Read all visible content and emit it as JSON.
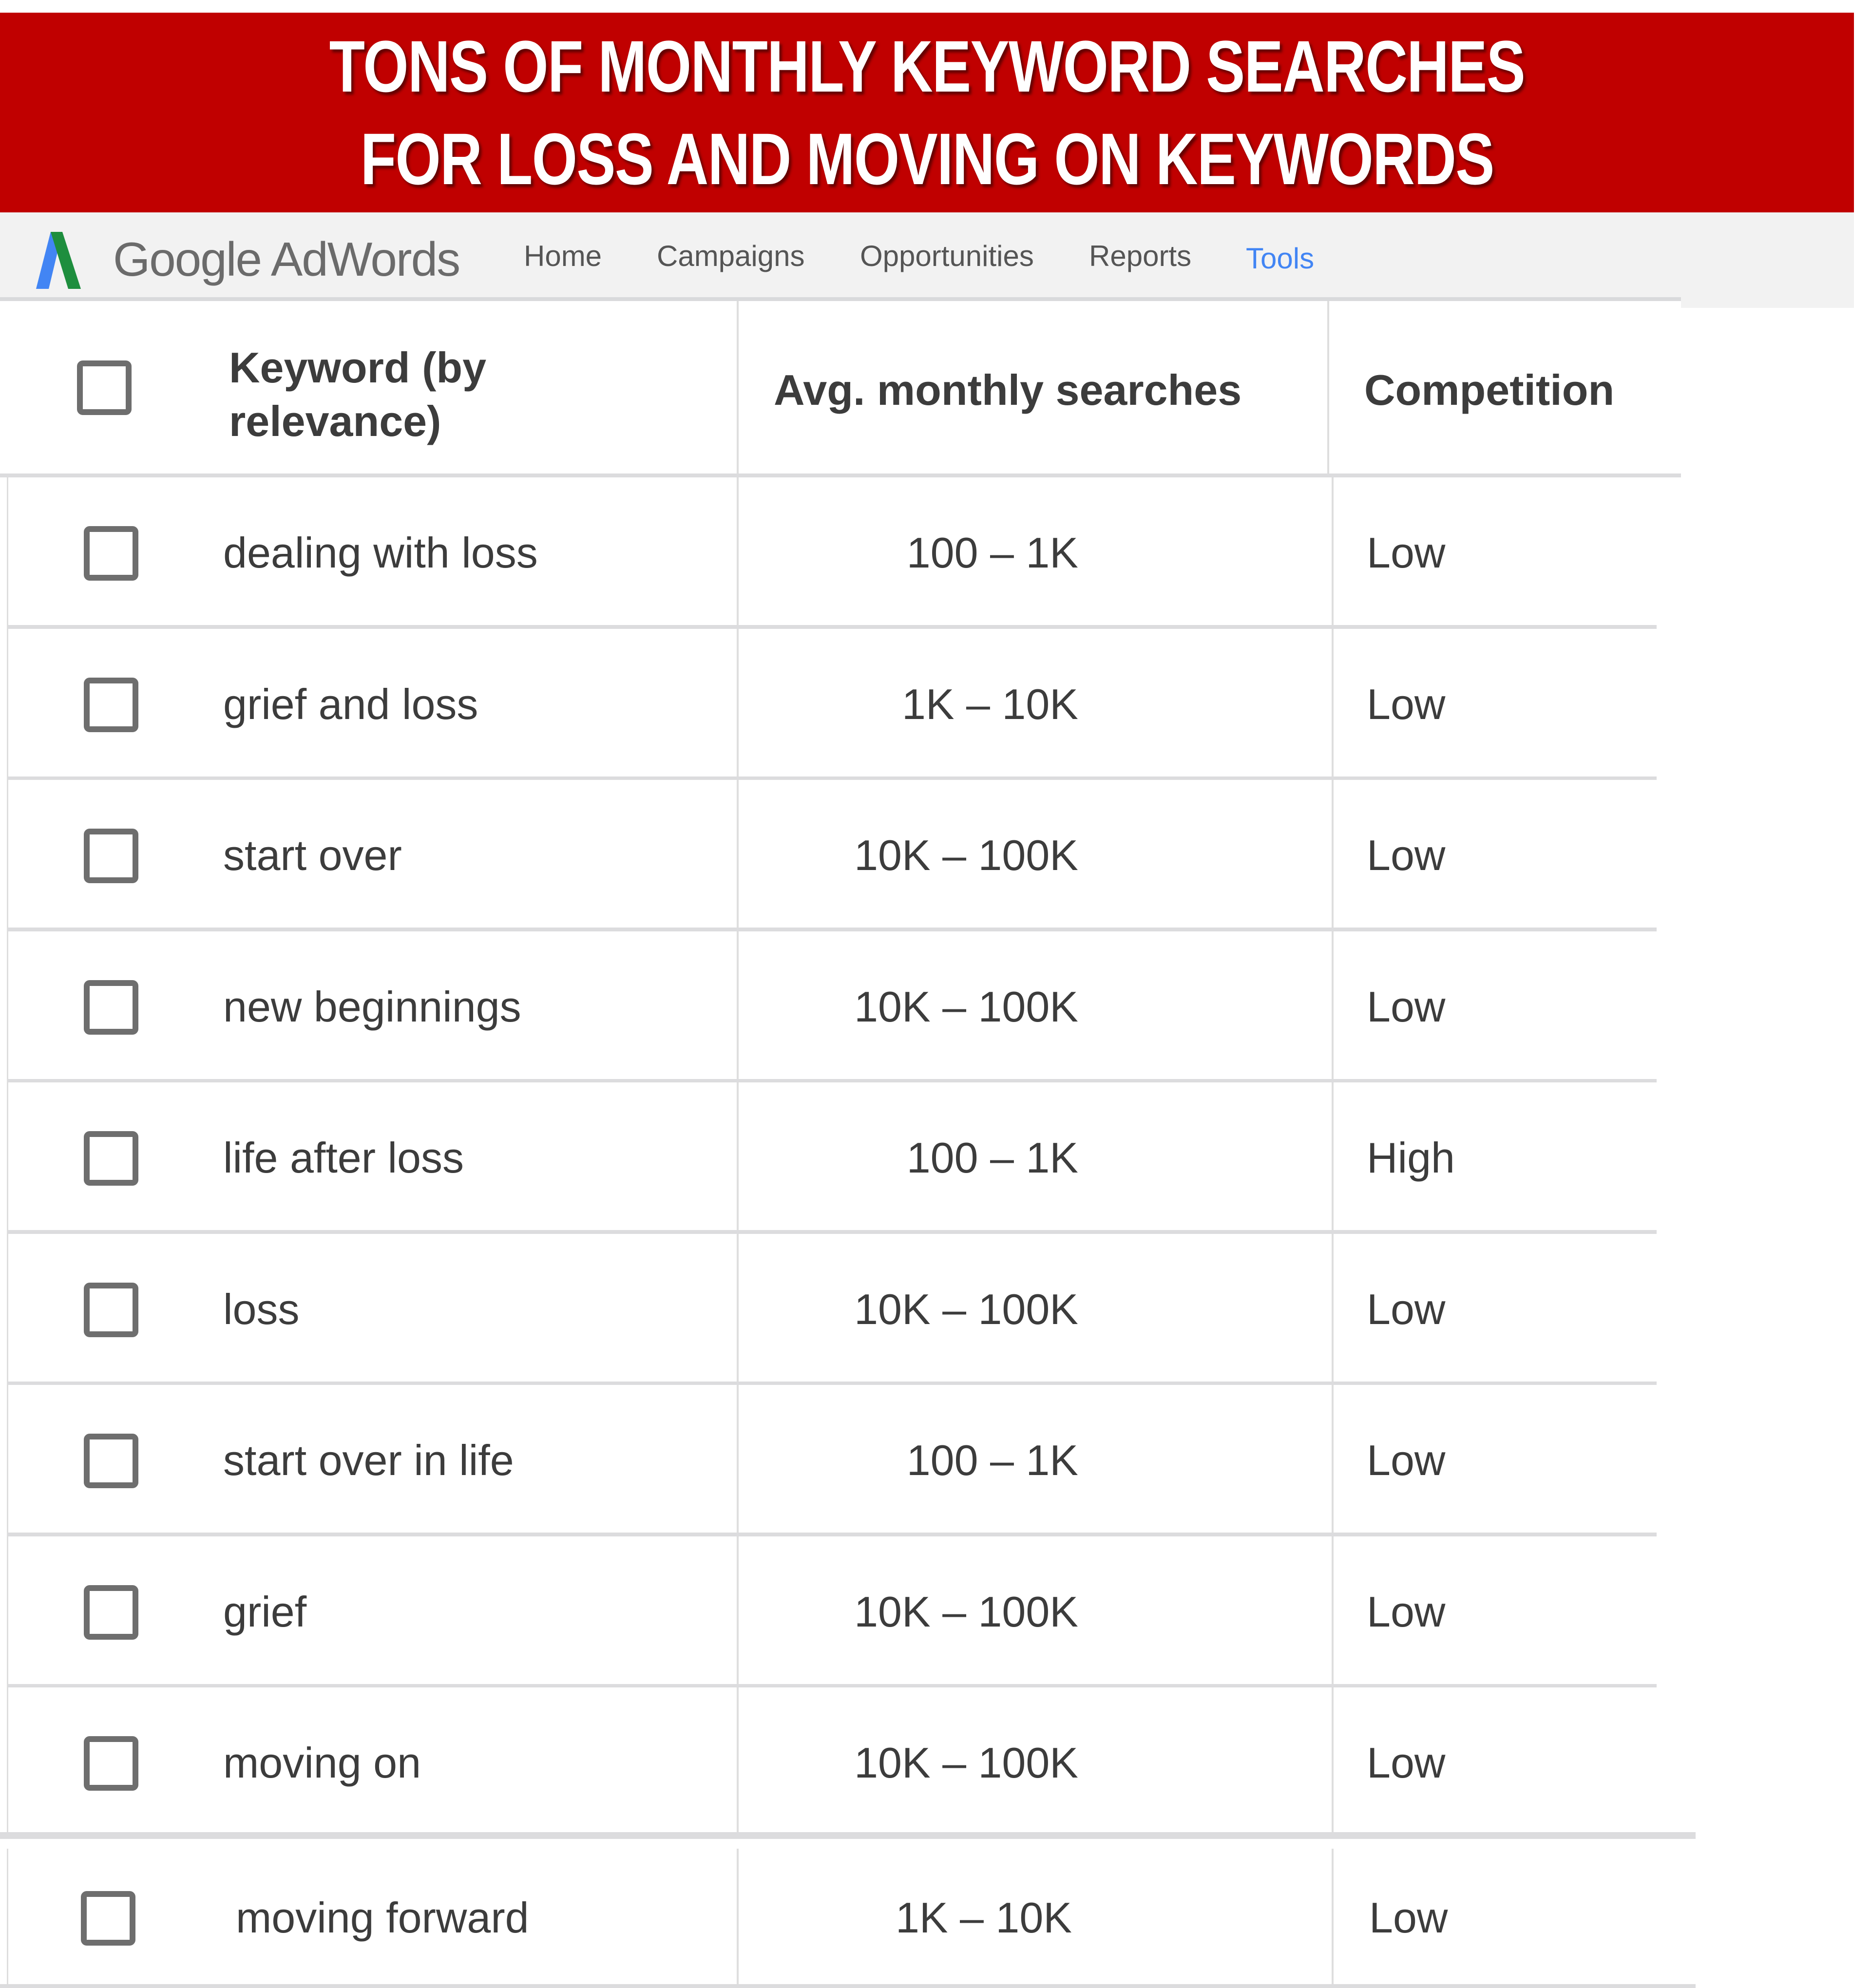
{
  "banner": {
    "line1": "TONS OF MONTHLY KEYWORD SEARCHES",
    "line2": "FOR LOSS AND MOVING ON KEYWORDS",
    "background_color": "#c00000"
  },
  "navbar": {
    "logo_icon": "google-adwords-logo",
    "brand": "Google AdWords",
    "items": [
      {
        "label": "Home",
        "active": false
      },
      {
        "label": "Campaigns",
        "active": false
      },
      {
        "label": "Opportunities",
        "active": false
      },
      {
        "label": "Reports",
        "active": false
      },
      {
        "label": "Tools",
        "active": true
      }
    ],
    "active_color": "#4285f4"
  },
  "table": {
    "headers": {
      "keyword_line1": "Keyword (by",
      "keyword_line2": "relevance)",
      "searches": "Avg. monthly searches",
      "competition": "Competition"
    },
    "rows": [
      {
        "keyword": "dealing with loss",
        "searches": "100 – 1K",
        "competition": "Low",
        "checked": false
      },
      {
        "keyword": "grief and loss",
        "searches": "1K – 10K",
        "competition": "Low",
        "checked": false
      },
      {
        "keyword": "start over",
        "searches": "10K – 100K",
        "competition": "Low",
        "checked": false
      },
      {
        "keyword": "new beginnings",
        "searches": "10K – 100K",
        "competition": "Low",
        "checked": false
      },
      {
        "keyword": "life after loss",
        "searches": "100 – 1K",
        "competition": "High",
        "checked": false
      },
      {
        "keyword": "loss",
        "searches": "10K – 100K",
        "competition": "Low",
        "checked": false
      },
      {
        "keyword": "start over in life",
        "searches": "100 – 1K",
        "competition": "Low",
        "checked": false
      },
      {
        "keyword": "grief",
        "searches": "10K – 100K",
        "competition": "Low",
        "checked": false
      },
      {
        "keyword": "moving on",
        "searches": "10K – 100K",
        "competition": "Low",
        "checked": false
      },
      {
        "keyword": "moving forward",
        "searches": "1K – 10K",
        "competition": "Low",
        "checked": false
      }
    ]
  }
}
